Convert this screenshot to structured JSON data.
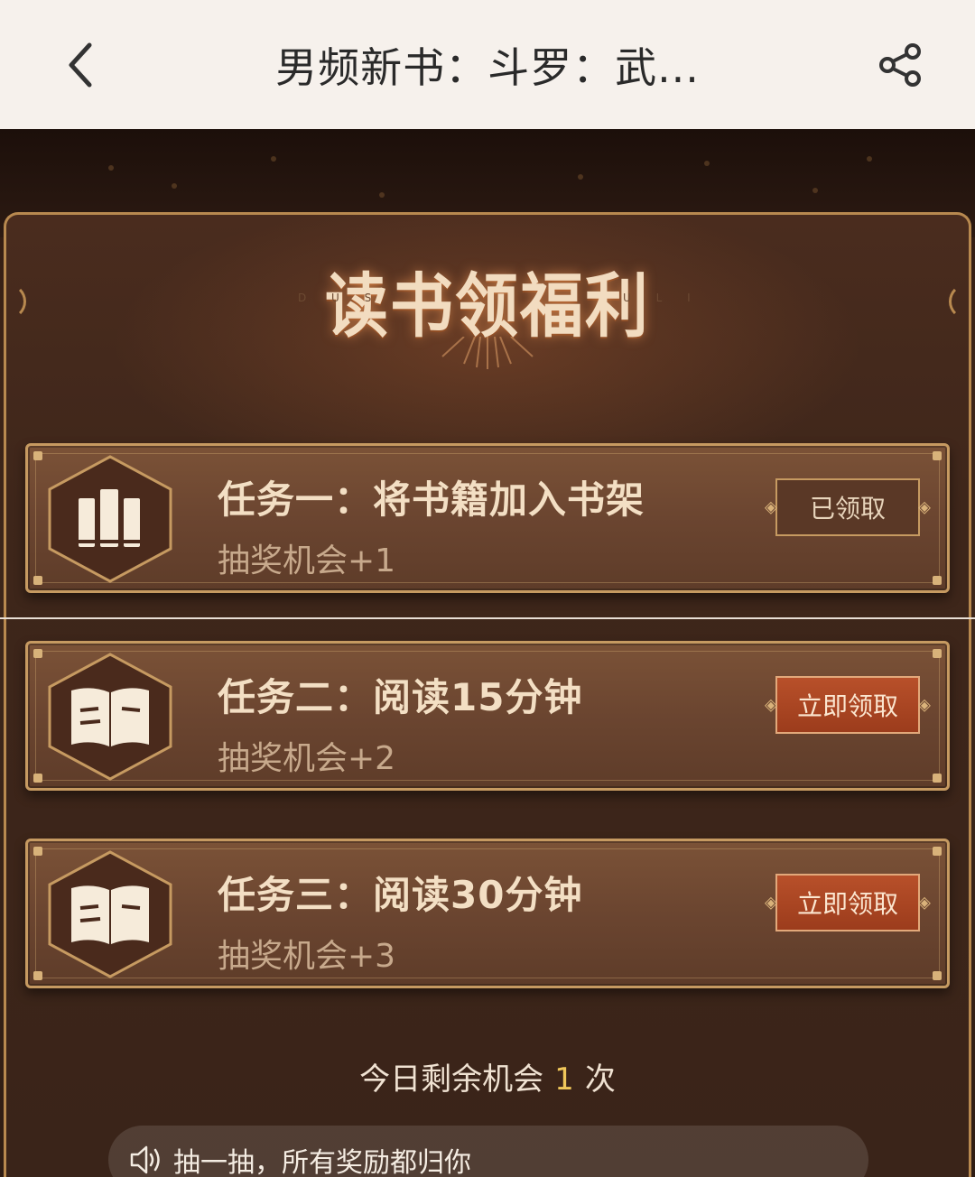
{
  "header": {
    "title": "男频新书：斗罗：武..."
  },
  "banner": {
    "headline": "读书领福利",
    "deco_left": "D U S",
    "deco_right": "U L I"
  },
  "tasks": [
    {
      "title": "任务一：将书籍加入书架",
      "reward": "抽奖机会+1",
      "button": "已领取",
      "state": "claimed",
      "icon": "bookshelf-icon"
    },
    {
      "title": "任务二：阅读15分钟",
      "reward": "抽奖机会+2",
      "button": "立即领取",
      "state": "active",
      "icon": "open-book-icon"
    },
    {
      "title": "任务三：阅读30分钟",
      "reward": "抽奖机会+3",
      "button": "立即领取",
      "state": "active",
      "icon": "open-book-icon"
    }
  ],
  "remaining": {
    "prefix": "今日剩余机会",
    "count": "1",
    "suffix": "次"
  },
  "notice": {
    "icon": "speaker-icon",
    "text": "抽一抽，所有奖励都归你"
  },
  "colors": {
    "accent_gold": "#c69a61",
    "button_active": "#b8502a",
    "count_highlight": "#f0c75a"
  }
}
